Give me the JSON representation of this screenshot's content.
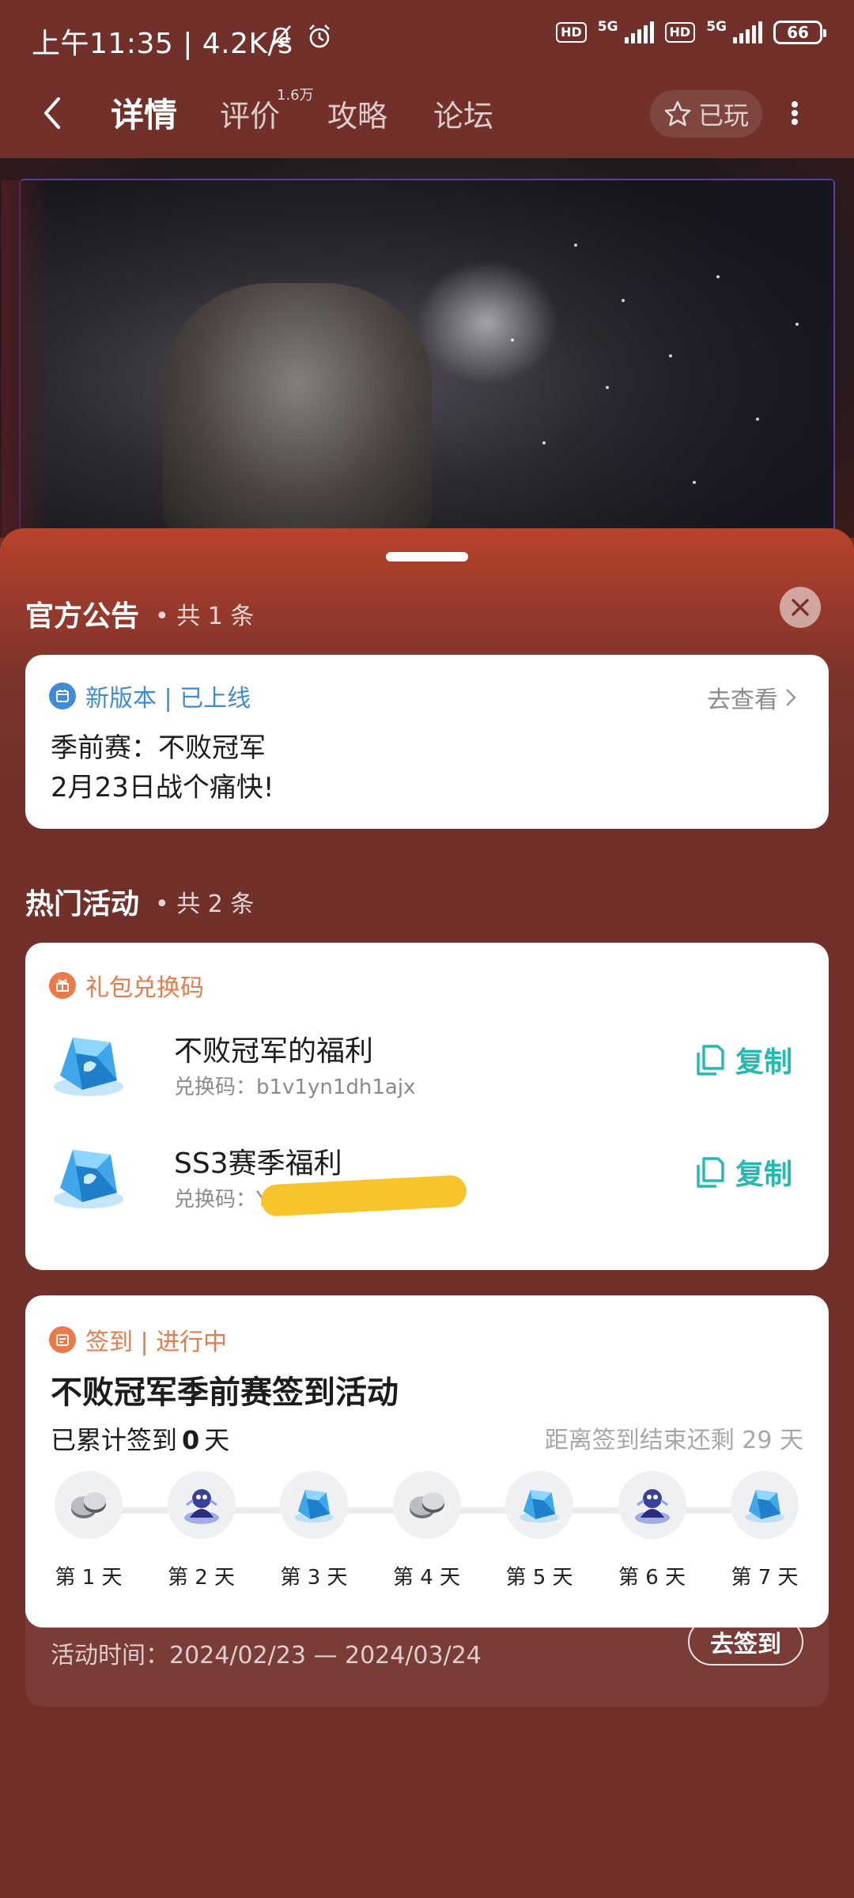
{
  "status_bar": {
    "time": "上午11:35",
    "speed": "4.2K/s",
    "hd1": "HD",
    "fiveg1": "5G",
    "hd2": "HD",
    "fiveg2": "5G",
    "battery": "66"
  },
  "nav": {
    "tabs": [
      {
        "label": "详情",
        "active": true
      },
      {
        "label": "评价",
        "badge": "1.6万"
      },
      {
        "label": "攻略"
      },
      {
        "label": "论坛"
      }
    ],
    "played_label": "已玩"
  },
  "announcement_section": {
    "title": "官方公告",
    "count": "• 共 1 条",
    "card": {
      "tag": "新版本 | 已上线",
      "link": "去查看",
      "lines": [
        "季前赛：不败冠军",
        "2月23日战个痛快!"
      ]
    }
  },
  "activity_section": {
    "title": "热门活动",
    "count": "• 共 2 条",
    "gift_card": {
      "tag": "礼包兑换码",
      "items": [
        {
          "name": "不败冠军的福利",
          "code": "兑换码：b1v1yn1dh1ajx",
          "copy": "复制"
        },
        {
          "name": "SS3赛季福利",
          "code": "兑换码：Y",
          "copy": "复制"
        }
      ]
    },
    "checkin_card": {
      "tag": "签到 | 进行中",
      "title": "不败冠军季前赛签到活动",
      "progress_prefix": "已累计签到",
      "progress_value": "0",
      "progress_suffix": "天",
      "remaining": "距离签到结束还剩 29 天",
      "days": [
        {
          "label": "第 1 天",
          "reward": "coin-icon"
        },
        {
          "label": "第 2 天",
          "reward": "character-icon"
        },
        {
          "label": "第 3 天",
          "reward": "gem-icon"
        },
        {
          "label": "第 4 天",
          "reward": "coin-icon"
        },
        {
          "label": "第 5 天",
          "reward": "gem-icon"
        },
        {
          "label": "第 6 天",
          "reward": "character-icon"
        },
        {
          "label": "第 7 天",
          "reward": "gem-icon"
        }
      ],
      "period": "活动时间：2024/02/23 — 2024/03/24",
      "checkin_button": "去签到"
    }
  },
  "colors": {
    "background": "#71302a",
    "accent_blue": "#3f8bd8",
    "accent_orange": "#ea7a4a",
    "accent_teal": "#26b9b1"
  }
}
